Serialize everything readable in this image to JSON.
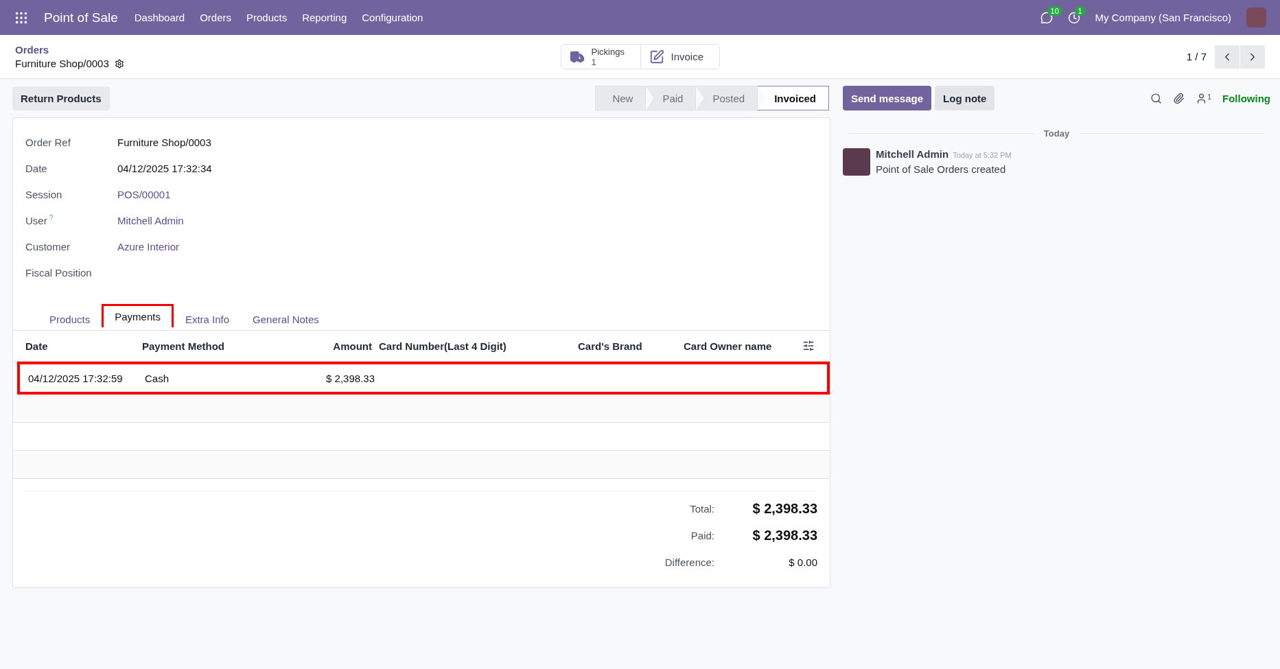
{
  "navbar": {
    "app": "Point of Sale",
    "menu": [
      "Dashboard",
      "Orders",
      "Products",
      "Reporting",
      "Configuration"
    ],
    "messages_count": "10",
    "activities_count": "1",
    "company": "My Company (San Francisco)"
  },
  "breadcrumb": {
    "parent": "Orders",
    "current": "Furniture Shop/0003"
  },
  "smart_buttons": [
    {
      "kind": "stat",
      "label": "Pickings",
      "value": "1"
    },
    {
      "kind": "plain",
      "label": "Invoice"
    }
  ],
  "pager": "1 / 7",
  "actions": [
    "Return Products"
  ],
  "statusbar": [
    {
      "label": "New",
      "selected": false
    },
    {
      "label": "Paid",
      "selected": false
    },
    {
      "label": "Posted",
      "selected": false
    },
    {
      "label": "Invoiced",
      "selected": true
    }
  ],
  "fields": [
    {
      "label": "Order Ref",
      "value": "Furniture Shop/0003",
      "kind": "text"
    },
    {
      "label": "Date",
      "value": "04/12/2025 17:32:34",
      "kind": "text"
    },
    {
      "label": "Session",
      "value": "POS/00001",
      "kind": "link"
    },
    {
      "label": "User",
      "help": "?",
      "value": "Mitchell Admin",
      "kind": "link"
    },
    {
      "label": "Customer",
      "value": "Azure Interior",
      "kind": "link"
    },
    {
      "label": "Fiscal Position"
    }
  ],
  "tabs": [
    {
      "label": "Products",
      "selected": false,
      "annotated": false
    },
    {
      "label": "Payments",
      "selected": true,
      "annotated": true
    },
    {
      "label": "Extra Info",
      "selected": false,
      "annotated": false
    },
    {
      "label": "General Notes",
      "selected": false,
      "annotated": false
    }
  ],
  "payments": {
    "columns": [
      {
        "label": "Date",
        "kind": "text"
      },
      {
        "label": "Payment Method",
        "kind": "text"
      },
      {
        "label": "Amount",
        "kind": "monetary"
      },
      {
        "label": "Card Number(Last 4 Digit)",
        "kind": "text"
      },
      {
        "label": "Card's Brand",
        "kind": "text"
      },
      {
        "label": "Card Owner name",
        "kind": "text"
      }
    ],
    "rows": [
      {
        "cells": [
          "04/12/2025 17:32:59",
          "Cash",
          "$ 2,398.33"
        ],
        "annotated": true
      }
    ]
  },
  "totals": [
    {
      "label": "Total:",
      "value": "$ 2,398.33",
      "emphasis": true
    },
    {
      "label": "Paid:",
      "value": "$ 2,398.33",
      "emphasis": true
    },
    {
      "label": "Difference:",
      "value": "$ 0.00",
      "emphasis": false
    }
  ],
  "chatter": {
    "buttons": [
      {
        "label": "Send message",
        "kind": "primary"
      },
      {
        "label": "Log note",
        "kind": "secondary"
      }
    ],
    "followers_count": "1",
    "follow_label": "Following",
    "date_separator": "Today",
    "messages": [
      {
        "author": "Mitchell Admin",
        "time": "Today at 5:32 PM",
        "body": "Point of Sale Orders created"
      }
    ]
  }
}
